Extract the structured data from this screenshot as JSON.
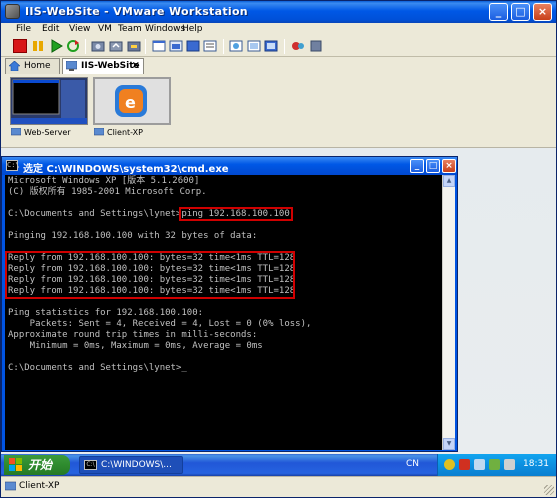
{
  "window": {
    "title": "IIS-WebSite - VMware Workstation",
    "minimize": "_",
    "maximize": "□",
    "close": "×"
  },
  "menu": [
    "File",
    "Edit",
    "View",
    "VM",
    "Team",
    "Windows",
    "Help"
  ],
  "toolbar": {
    "icons": [
      "power-off-icon",
      "pause-icon",
      "power-on-icon",
      "reset-icon",
      "snapshot-icon",
      "revert-snapshot-icon",
      "snapshot-manager-icon",
      "normal-view-icon",
      "quick-switch-icon",
      "fullscreen-icon",
      "summary-view-icon",
      "console-view-icon",
      "appliance-view-icon",
      "shared-folders-icon",
      "preferences-icon"
    ]
  },
  "tabs": [
    {
      "label": "Home",
      "active": false
    },
    {
      "label": "IIS-WebSite",
      "active": true,
      "close": "×"
    }
  ],
  "thumbnails": [
    {
      "label": "Web-Server"
    },
    {
      "label": "Client-XP"
    }
  ],
  "cmd_window": {
    "title": "选定 C:\\WINDOWS\\system32\\cmd.exe",
    "icon_text": "C:\\",
    "lines": [
      "Microsoft Windows XP [版本 5.1.2600]",
      "(C) 版权所有 1985-2001 Microsoft Corp.",
      "",
      "C:\\Documents and Settings\\lynet>ping 192.168.100.100",
      "",
      "Pinging 192.168.100.100 with 32 bytes of data:",
      "",
      "Reply from 192.168.100.100: bytes=32 time<1ms TTL=128",
      "Reply from 192.168.100.100: bytes=32 time<1ms TTL=128",
      "Reply from 192.168.100.100: bytes=32 time<1ms TTL=128",
      "Reply from 192.168.100.100: bytes=32 time<1ms TTL=128",
      "",
      "Ping statistics for 192.168.100.100:",
      "    Packets: Sent = 4, Received = 4, Lost = 0 (0% loss),",
      "Approximate round trip times in milli-seconds:",
      "    Minimum = 0ms, Maximum = 0ms, Average = 0ms",
      "",
      "C:\\Documents and Settings\\lynet>_"
    ]
  },
  "taskbar": {
    "start": "开始",
    "item": "C:\\WINDOWS\\...",
    "item_icon": "C:\\",
    "language": "CN",
    "clock": "18:31"
  },
  "statusbar": {
    "text": "Client-XP"
  }
}
